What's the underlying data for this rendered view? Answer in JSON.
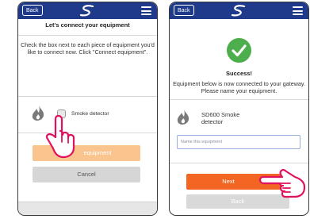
{
  "left_screen": {
    "header": {
      "back_label": "Back",
      "logo_icon": "brand-swirl-icon",
      "menu_icon": "hamburger-menu-icon"
    },
    "title": "Let's connect your equipment",
    "instructions": "Check the box next to each piece of equipment you'd like to connect now. Click \"Connect equipment\".",
    "device": {
      "icon": "flame-icon",
      "label": "Smoke detector",
      "checked": false
    },
    "connect_button_label": "equipment",
    "cancel_button_label": "Cancel",
    "pointer_icon": "hand-pointer-icon"
  },
  "right_screen": {
    "header": {
      "back_label": "Back",
      "logo_icon": "brand-swirl-icon",
      "menu_icon": "hamburger-menu-icon"
    },
    "success_icon": "checkmark-circle-icon",
    "success_title": "Success!",
    "success_message": "Equipment below is now connected to your gateway. Please name your equipment.",
    "device": {
      "icon": "flame-icon",
      "line1": "SD600 Smoke",
      "line2": "detector"
    },
    "name_input": {
      "placeholder": "Name this equipment",
      "value": ""
    },
    "next_button_label": "Next",
    "back_button_label": "Back",
    "pointer_icon": "hand-pointer-icon"
  },
  "colors": {
    "header_blue": "#1f3a8a",
    "primary_orange": "#f26522",
    "disabled_orange": "#f9c48e",
    "success_green": "#4cae4c",
    "button_gray": "#d6d6d6"
  }
}
